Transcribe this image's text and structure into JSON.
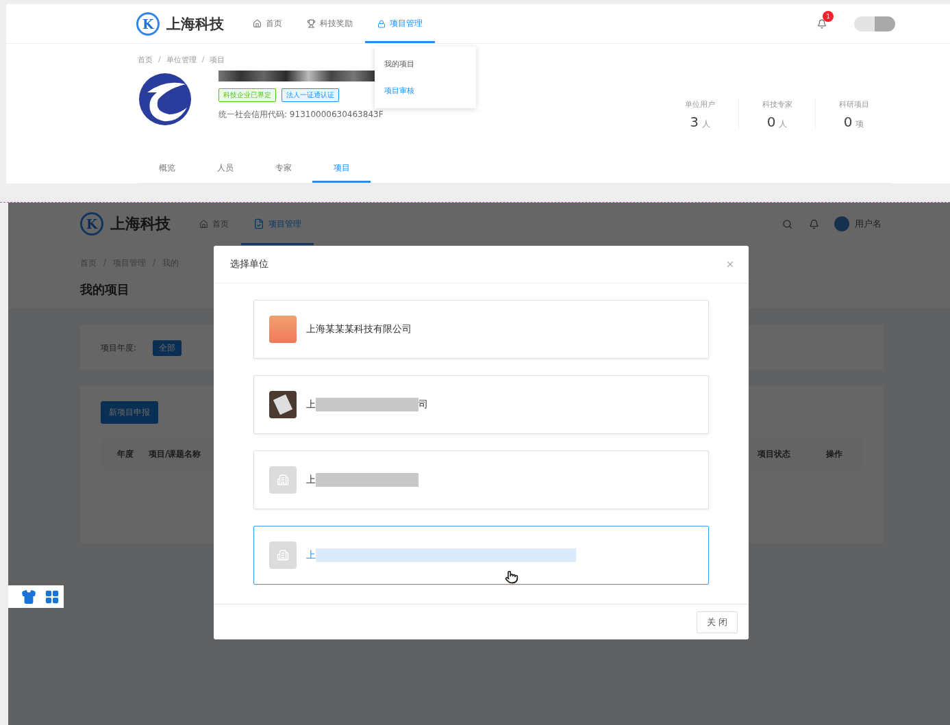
{
  "top_page": {
    "logo_letter": "K",
    "brand": "上海科技",
    "nav": [
      {
        "label": "首页",
        "kind": "home",
        "selected": false
      },
      {
        "label": "科技奖励",
        "kind": "trophy",
        "selected": false
      },
      {
        "label": "项目管理",
        "kind": "lock",
        "selected": true
      }
    ],
    "notification_count": "1",
    "dropdown": [
      {
        "label": "我的项目",
        "selected": false
      },
      {
        "label": "项目审核",
        "selected": true
      }
    ],
    "breadcrumb": [
      "首页",
      "单位管理",
      "项目"
    ],
    "breadcrumb_separator": "/",
    "tags": [
      {
        "label": "科技企业已界定",
        "color": "#52c41a"
      },
      {
        "label": "法人一证通认证",
        "color": "#1890ff"
      }
    ],
    "credit_code": "统一社会信用代码: 91310000630463843F",
    "stats": [
      {
        "label": "单位用户",
        "value": "3",
        "unit": "人"
      },
      {
        "label": "科技专家",
        "value": "0",
        "unit": "人"
      },
      {
        "label": "科研项目",
        "value": "0",
        "unit": "项"
      }
    ],
    "tabs": [
      {
        "label": "概览",
        "selected": false
      },
      {
        "label": "人员",
        "selected": false
      },
      {
        "label": "专家",
        "selected": false
      },
      {
        "label": "项目",
        "selected": true
      }
    ]
  },
  "bottom_page": {
    "logo_letter": "K",
    "brand": "上海科技",
    "nav": [
      {
        "label": "首页",
        "kind": "home",
        "selected": false
      },
      {
        "label": "项目管理",
        "kind": "doc",
        "selected": true
      }
    ],
    "username": "用户名",
    "breadcrumb": [
      "首页",
      "项目管理",
      "我的"
    ],
    "breadcrumb_separator": "/",
    "title": "我的项目",
    "filter_label": "项目年度:",
    "filter_chip": "全部",
    "new_button": "新项目申报",
    "columns_left": [
      "年度",
      "项目/课题名称"
    ],
    "columns_right": [
      "项目状态",
      "操作"
    ],
    "modal": {
      "title": "选择单位",
      "units": [
        {
          "kind": "logo",
          "prefix": "上海某某某科技有限公司",
          "redacted": false,
          "selected": false
        },
        {
          "kind": "photo",
          "prefix": "上",
          "suffix": "司",
          "redacted": true,
          "selected": false
        },
        {
          "kind": "building",
          "prefix": "上",
          "redacted": true,
          "selected": false
        },
        {
          "kind": "building",
          "prefix": "上",
          "redacted": true,
          "selected": true
        }
      ],
      "close_button": "关 闭"
    }
  }
}
